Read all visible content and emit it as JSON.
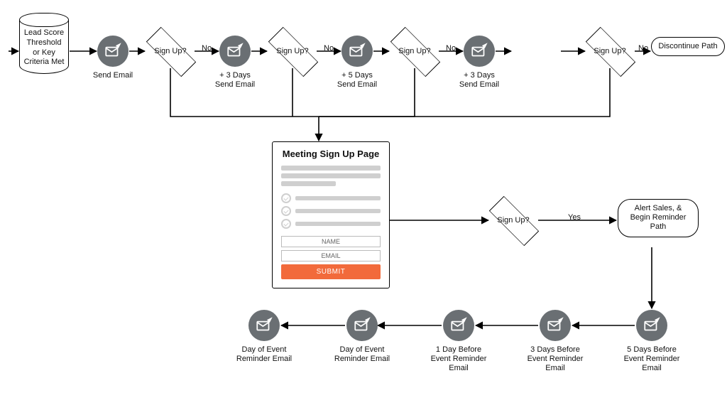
{
  "start": {
    "label": "Lead Score Threshold or Key Criteria Met"
  },
  "emails": [
    {
      "label": "Send Email"
    },
    {
      "label": "+ 3 Days\nSend Email"
    },
    {
      "label": "+ 5 Days\nSend Email"
    },
    {
      "label": "+ 3 Days\nSend Email"
    }
  ],
  "decision_label": "Sign Up?",
  "edge_no": "No",
  "edge_yes": "Yes",
  "terminators": {
    "discontinue": "Discontinue Path",
    "alert_path": "Alert Sales, & Begin Reminder Path"
  },
  "signup_page": {
    "title": "Meeting Sign Up Page",
    "name_placeholder": "NAME",
    "email_placeholder": "EMAIL",
    "submit_label": "SUBMIT"
  },
  "reminders": [
    {
      "label": "5 Days Before Event Reminder Email"
    },
    {
      "label": "3 Days Before Event Reminder Email"
    },
    {
      "label": "1 Day Before Event Reminder Email"
    },
    {
      "label": "Day of Event Reminder Email"
    }
  ]
}
